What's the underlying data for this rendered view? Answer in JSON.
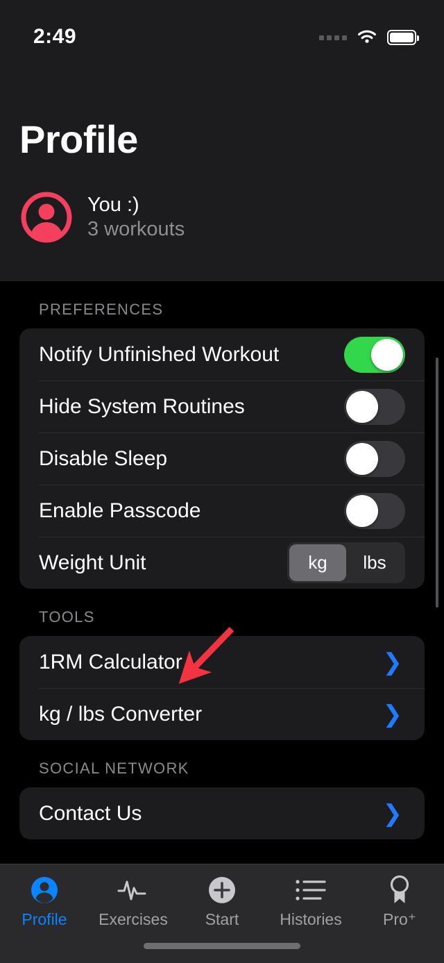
{
  "status_bar": {
    "time": "2:49",
    "icons": [
      "signal-dots-icon",
      "wifi-icon",
      "battery-icon"
    ]
  },
  "header": {
    "title": "Profile",
    "profile": {
      "name": "You :)",
      "subtitle": "3 workouts",
      "avatar_color": "#F43F5E"
    }
  },
  "sections": [
    {
      "header": "PREFERENCES",
      "rows": [
        {
          "label": "Notify Unfinished Workout",
          "control": "toggle",
          "state": "on"
        },
        {
          "label": "Hide System Routines",
          "control": "toggle",
          "state": "off"
        },
        {
          "label": "Disable Sleep",
          "control": "toggle",
          "state": "off"
        },
        {
          "label": "Enable Passcode",
          "control": "toggle",
          "state": "off"
        },
        {
          "label": "Weight Unit",
          "control": "segmented",
          "options": [
            "kg",
            "lbs"
          ],
          "selected": "kg"
        }
      ]
    },
    {
      "header": "TOOLS",
      "rows": [
        {
          "label": "1RM Calculator",
          "control": "chevron",
          "chevron": "❯"
        },
        {
          "label": "kg / lbs Converter",
          "control": "chevron",
          "chevron": "❯"
        }
      ]
    },
    {
      "header": "SOCIAL NETWORK",
      "rows": [
        {
          "label": "Contact Us",
          "control": "chevron",
          "chevron": "❯"
        }
      ]
    }
  ],
  "tab_bar": {
    "active": "Profile",
    "tabs": [
      {
        "label": "Profile",
        "icon": "person-circle-icon"
      },
      {
        "label": "Exercises",
        "icon": "pulse-waveform-icon"
      },
      {
        "label": "Start",
        "icon": "plus-circle-icon"
      },
      {
        "label": "Histories",
        "icon": "list-bullet-icon"
      },
      {
        "label": "Pro⁺",
        "icon": "medal-ribbon-icon"
      }
    ]
  },
  "annotation": {
    "type": "arrow",
    "color": "#F23342",
    "points_to": "1RM Calculator"
  },
  "colors": {
    "accent_blue": "#0A84FF",
    "toggle_on_green": "#32D74B",
    "toggle_off_gray": "#39393D",
    "card_background": "#1C1C1E",
    "page_background": "#000000",
    "secondary_text": "#8E8E93"
  }
}
